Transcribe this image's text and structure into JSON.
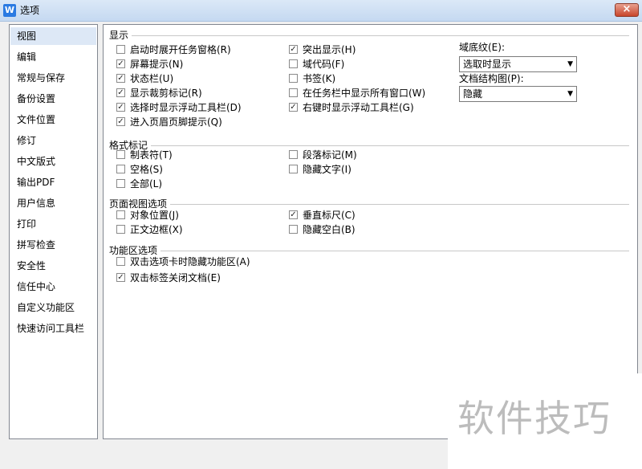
{
  "window": {
    "title": "选项",
    "app_icon_glyph": "W",
    "close_glyph": "×"
  },
  "sidebar": {
    "selected_index": 0,
    "items": [
      {
        "label": "视图"
      },
      {
        "label": "编辑"
      },
      {
        "label": "常规与保存"
      },
      {
        "label": "备份设置"
      },
      {
        "label": "文件位置"
      },
      {
        "label": "修订"
      },
      {
        "label": "中文版式"
      },
      {
        "label": "输出PDF"
      },
      {
        "label": "用户信息"
      },
      {
        "label": "打印"
      },
      {
        "label": "拼写检查"
      },
      {
        "label": "安全性"
      },
      {
        "label": "信任中心"
      },
      {
        "label": "自定义功能区"
      },
      {
        "label": "快速访问工具栏"
      }
    ]
  },
  "display": {
    "title": "显示",
    "left": [
      {
        "label": "启动时展开任务窗格(R)",
        "checked": false
      },
      {
        "label": "屏幕提示(N)",
        "checked": true
      },
      {
        "label": "状态栏(U)",
        "checked": true
      },
      {
        "label": "显示裁剪标记(R)",
        "checked": true
      },
      {
        "label": "选择时显示浮动工具栏(D)",
        "checked": true
      },
      {
        "label": "进入页眉页脚提示(Q)",
        "checked": true
      }
    ],
    "right": [
      {
        "label": "突出显示(H)",
        "checked": true
      },
      {
        "label": "域代码(F)",
        "checked": false
      },
      {
        "label": "书签(K)",
        "checked": false
      },
      {
        "label": "在任务栏中显示所有窗口(W)",
        "checked": false
      },
      {
        "label": "右键时显示浮动工具栏(G)",
        "checked": true
      }
    ],
    "field_shading": {
      "label": "域底纹(E):",
      "value": "选取时显示"
    },
    "doc_map": {
      "label": "文档结构图(P):",
      "value": "隐藏"
    }
  },
  "format_marks": {
    "title": "格式标记",
    "left": [
      {
        "label": "制表符(T)",
        "checked": false
      },
      {
        "label": "空格(S)",
        "checked": false
      },
      {
        "label": "全部(L)",
        "checked": false
      }
    ],
    "right": [
      {
        "label": "段落标记(M)",
        "checked": false
      },
      {
        "label": "隐藏文字(I)",
        "checked": false
      }
    ]
  },
  "page_view": {
    "title": "页面视图选项",
    "left": [
      {
        "label": "对象位置(J)",
        "checked": false
      },
      {
        "label": "正文边框(X)",
        "checked": false
      }
    ],
    "right": [
      {
        "label": "垂直标尺(C)",
        "checked": true
      },
      {
        "label": "隐藏空白(B)",
        "checked": false
      }
    ]
  },
  "ribbon": {
    "title": "功能区选项",
    "items": [
      {
        "label": "双击选项卡时隐藏功能区(A)",
        "checked": false
      },
      {
        "label": "双击标签关闭文档(E)",
        "checked": true
      }
    ]
  },
  "watermark": {
    "text": "软件技巧"
  },
  "icons": {
    "check": "✓",
    "dropdown": "▼"
  }
}
